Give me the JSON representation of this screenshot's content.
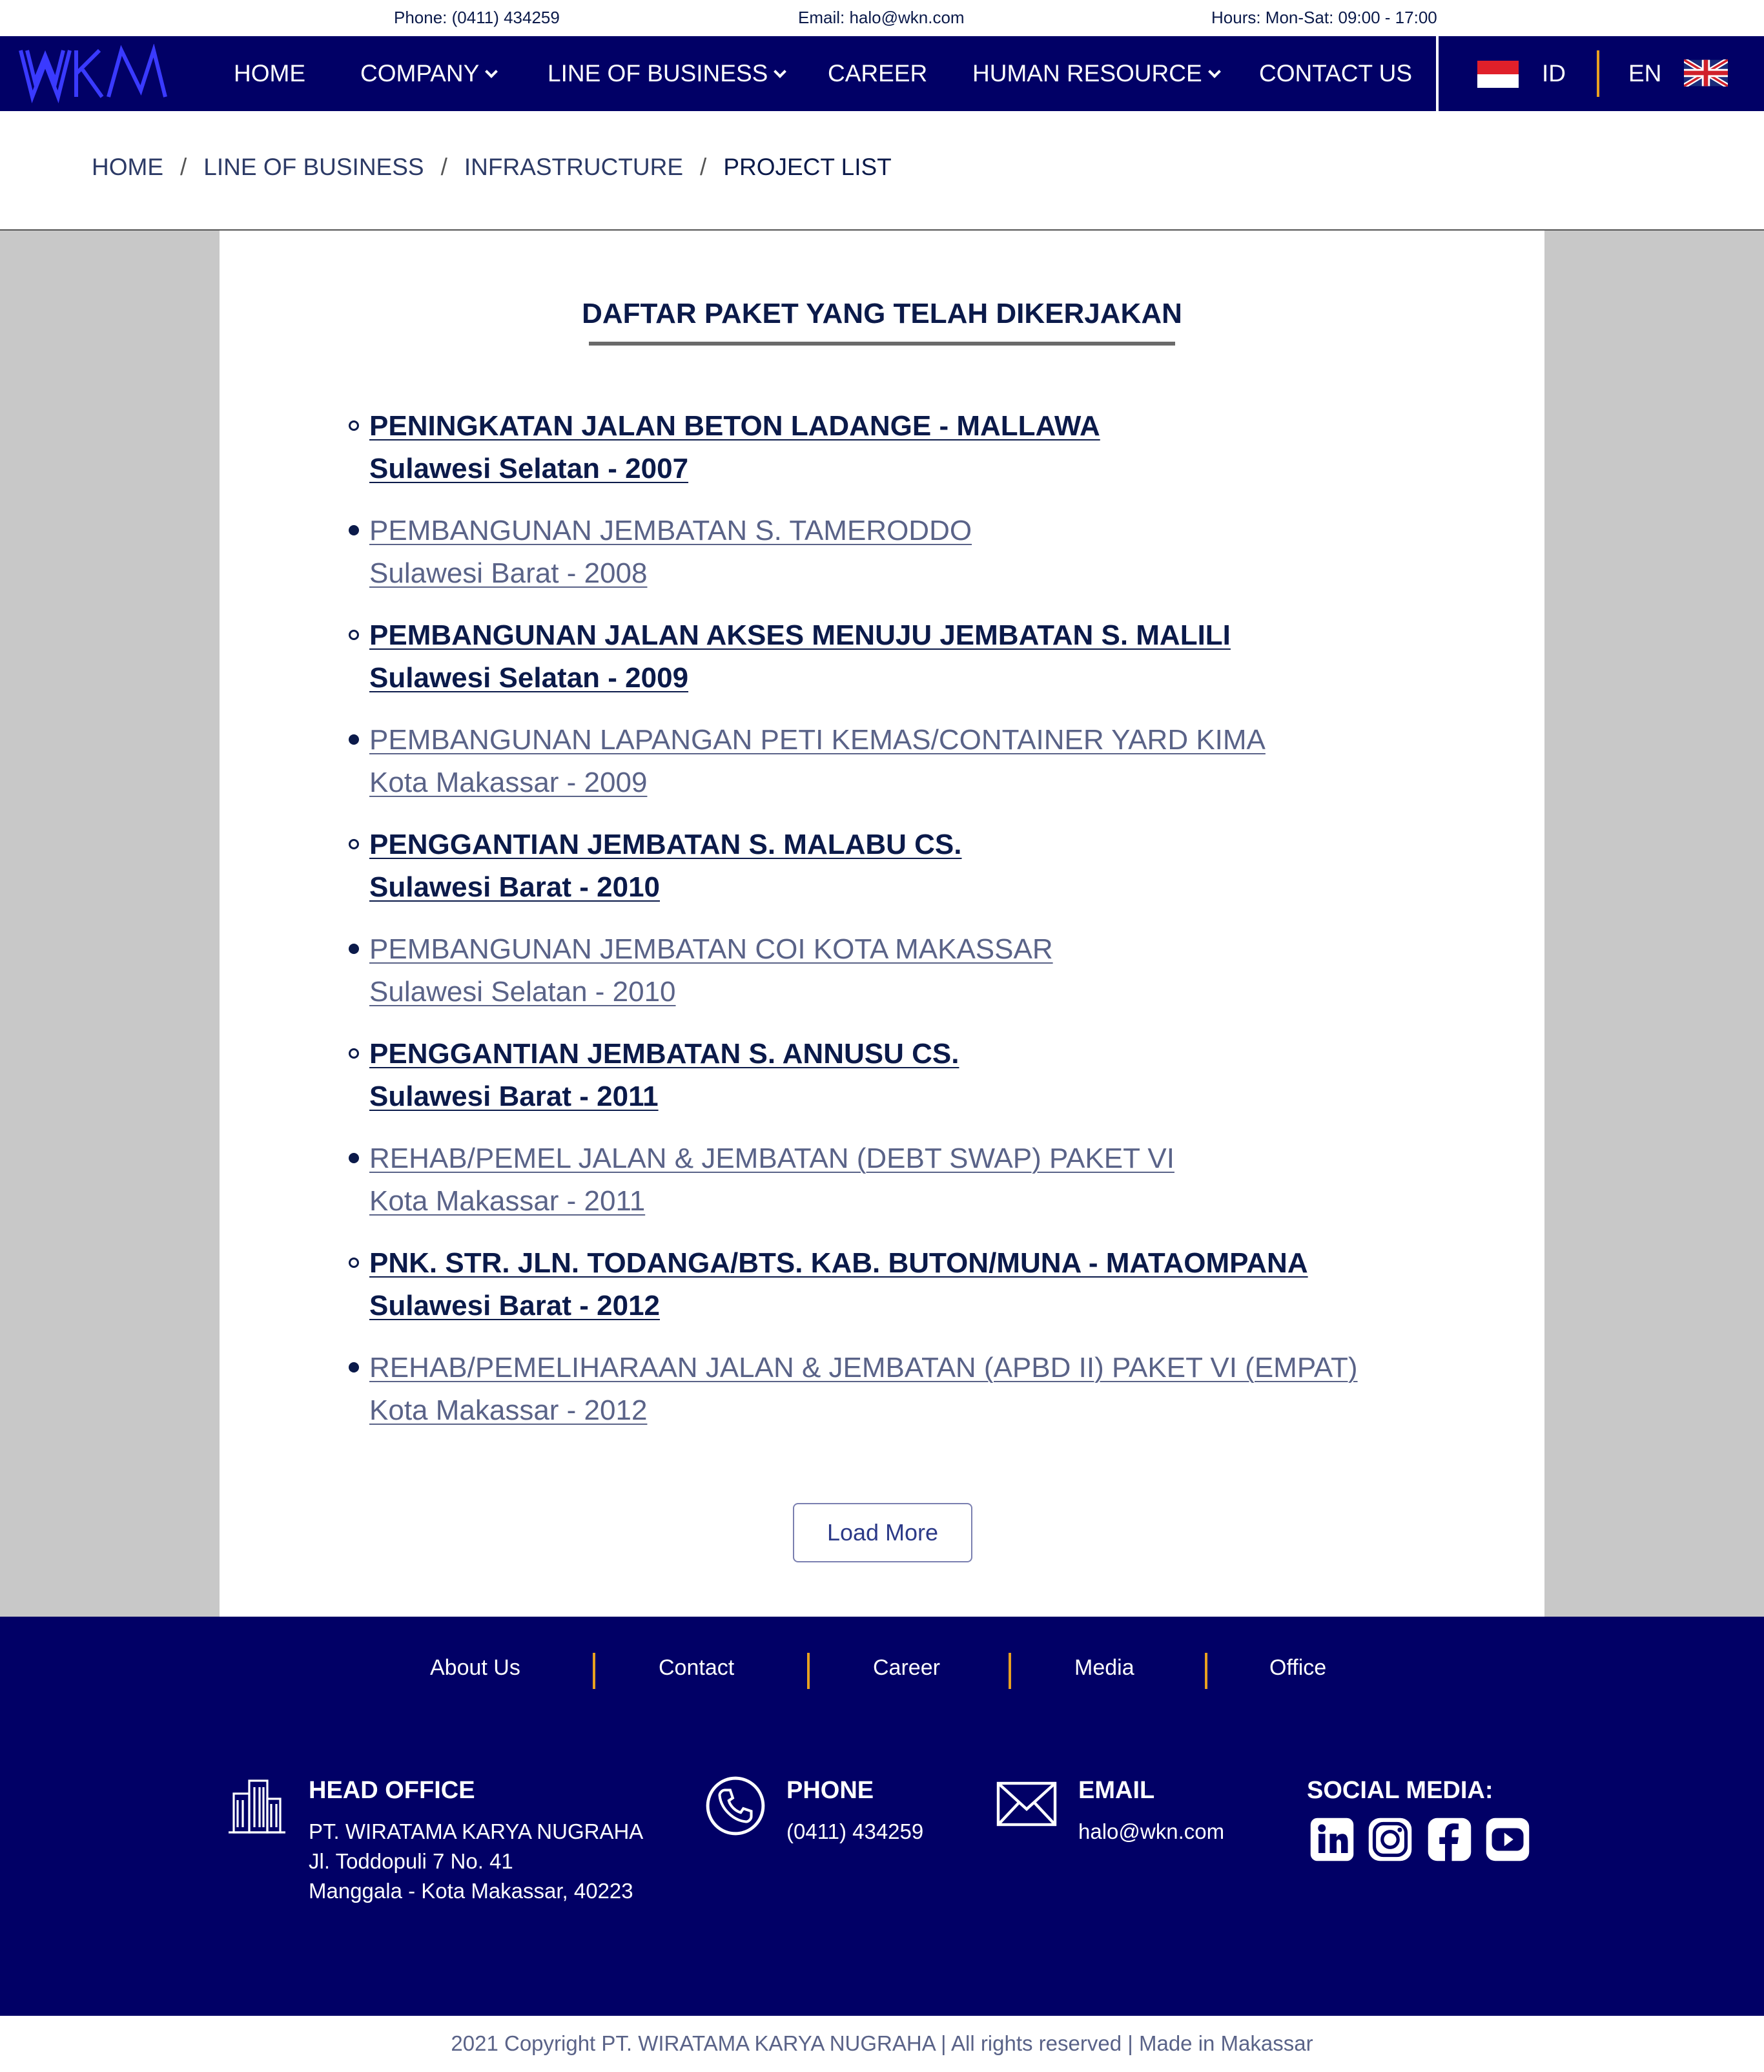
{
  "topbar": {
    "phone": "Phone: (0411) 434259",
    "email": "Email: halo@wkn.com",
    "hours": "Hours: Mon-Sat: 09:00 - 17:00"
  },
  "nav": {
    "logo_text": "WKN",
    "items": [
      {
        "label": "HOME",
        "dropdown": false
      },
      {
        "label": "COMPANY",
        "dropdown": true
      },
      {
        "label": "LINE OF BUSINESS",
        "dropdown": true
      },
      {
        "label": "CAREER",
        "dropdown": false
      },
      {
        "label": "HUMAN RESOURCE",
        "dropdown": true
      },
      {
        "label": "CONTACT US",
        "dropdown": false
      }
    ],
    "lang_id": "ID",
    "lang_en": "EN"
  },
  "breadcrumb": {
    "items": [
      "HOME",
      "LINE OF BUSINESS",
      "INFRASTRUCTURE"
    ],
    "separator": "/",
    "current": "PROJECT LIST"
  },
  "main": {
    "title": "DAFTAR PAKET YANG TELAH DIKERJAKAN",
    "projects": [
      {
        "name": "PENINGKATAN JALAN BETON LADANGE - MALLAWA",
        "location": "Sulawesi Selatan - 2007",
        "style": "bold"
      },
      {
        "name": "PEMBANGUNAN JEMBATAN S. TAMERODDO",
        "location": "Sulawesi Barat - 2008",
        "style": "light"
      },
      {
        "name": "PEMBANGUNAN JALAN AKSES MENUJU JEMBATAN S. MALILI",
        "location": "Sulawesi Selatan - 2009",
        "style": "bold"
      },
      {
        "name": "PEMBANGUNAN LAPANGAN PETI KEMAS/CONTAINER YARD KIMA",
        "location": "Kota Makassar - 2009",
        "style": "light"
      },
      {
        "name": "PENGGANTIAN JEMBATAN S. MALABU CS.",
        "location": "Sulawesi Barat - 2010",
        "style": "bold"
      },
      {
        "name": "PEMBANGUNAN JEMBATAN COI KOTA MAKASSAR",
        "location": "Sulawesi Selatan - 2010",
        "style": "light"
      },
      {
        "name": "PENGGANTIAN JEMBATAN S. ANNUSU CS.",
        "location": "Sulawesi Barat - 2011",
        "style": "bold"
      },
      {
        "name": "REHAB/PEMEL JALAN & JEMBATAN (DEBT SWAP) PAKET VI",
        "location": "Kota Makassar - 2011",
        "style": "light"
      },
      {
        "name": "PNK. STR. JLN. TODANGA/BTS. KAB. BUTON/MUNA - MATAOMPANA",
        "location": "Sulawesi Barat - 2012",
        "style": "bold"
      },
      {
        "name": "REHAB/PEMELIHARAAN JALAN & JEMBATAN (APBD II) PAKET VI (EMPAT)",
        "location": "Kota Makassar - 2012",
        "style": "light"
      }
    ],
    "load_more": "Load More"
  },
  "footer": {
    "links": [
      "About Us",
      "Contact",
      "Career",
      "Media",
      "Office"
    ],
    "head_office": {
      "heading": "HEAD OFFICE",
      "line1": "PT. WIRATAMA KARYA NUGRAHA",
      "line2": "Jl. Toddopuli 7 No. 41",
      "line3": "Manggala - Kota Makassar, 40223"
    },
    "phone": {
      "heading": "PHONE",
      "value": "(0411) 434259"
    },
    "email": {
      "heading": "EMAIL",
      "value": "halo@wkn.com"
    },
    "social": {
      "heading": "SOCIAL MEDIA:",
      "icons": [
        "linkedin-icon",
        "instagram-icon",
        "facebook-icon",
        "youtube-icon"
      ]
    },
    "copyright": "2021 Copyright PT. WIRATAMA KARYA NUGRAHA |  All rights reserved | Made in Makassar"
  },
  "colors": {
    "nav_bg": "#010066",
    "accent": "#e8a020",
    "text_dark": "#0b1a4a",
    "side_gray": "#c8c8c8"
  }
}
